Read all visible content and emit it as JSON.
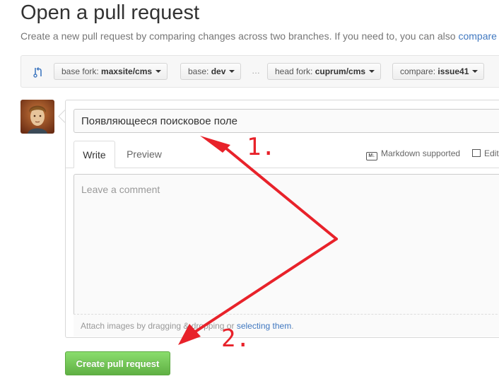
{
  "page": {
    "title": "Open a pull request",
    "subtitle_text": "Create a new pull request by comparing changes across two branches. If you need to, you can also ",
    "subtitle_link": "compare"
  },
  "range": {
    "icon": "git-compare-icon",
    "base_fork_label": "base fork: ",
    "base_fork_value": "maxsite/cms",
    "base_label": "base: ",
    "base_value": "dev",
    "ellipsis": "…",
    "head_fork_label": "head fork: ",
    "head_fork_value": "cuprum/cms",
    "compare_label": "compare: ",
    "compare_value": "issue41"
  },
  "form": {
    "title_value": "Появляющееся поисковое поле",
    "tabs": [
      {
        "label": "Write",
        "active": true
      },
      {
        "label": "Preview",
        "active": false
      }
    ],
    "markdown_note": "Markdown supported",
    "markdown_icon_text": "M↓",
    "edit_note": "Edit",
    "comment_placeholder": "Leave a comment",
    "attach_text_before": "Attach images by dragging & dropping or ",
    "attach_link": "selecting them",
    "attach_text_after": ".",
    "submit_label": "Create pull request"
  },
  "annotations": {
    "color": "#e8222a",
    "label_1": "1.",
    "label_2": "2."
  }
}
